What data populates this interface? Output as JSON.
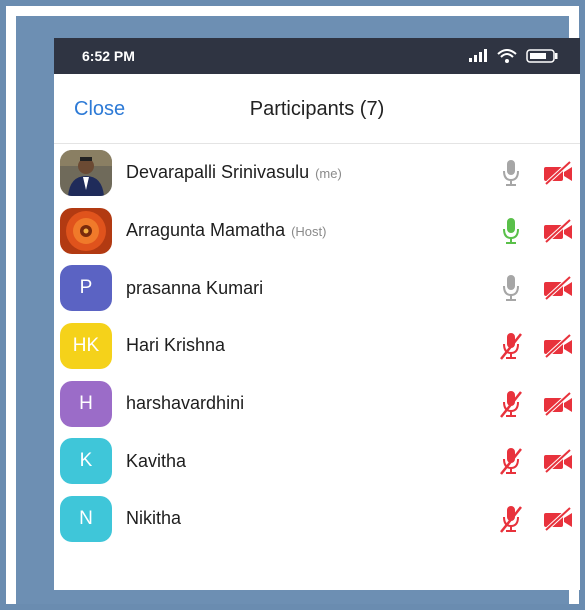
{
  "status_bar": {
    "time": "6:52 PM"
  },
  "header": {
    "close_label": "Close",
    "title": "Participants (7)"
  },
  "participants": [
    {
      "name": "Devarapalli Srinivasulu",
      "tag": "(me)",
      "avatar": "photo",
      "mic": "on",
      "video": "off"
    },
    {
      "name": "Arragunta Mamatha",
      "tag": "(Host)",
      "avatar": "photo",
      "mic": "speaking",
      "video": "off"
    },
    {
      "name": "prasanna Kumari",
      "tag": "",
      "avatar": "P",
      "avatar_color": "#5b63c3",
      "mic": "on",
      "video": "off"
    },
    {
      "name": "Hari Krishna",
      "tag": "",
      "avatar": "HK",
      "avatar_color": "#f5d21a",
      "mic": "muted",
      "video": "off"
    },
    {
      "name": "harshavardhini",
      "tag": "",
      "avatar": "H",
      "avatar_color": "#9b6cc8",
      "mic": "muted",
      "video": "off"
    },
    {
      "name": "Kavitha",
      "tag": "",
      "avatar": "K",
      "avatar_color": "#3fc6d9",
      "mic": "muted",
      "video": "off"
    },
    {
      "name": "Nikitha",
      "tag": "",
      "avatar": "N",
      "avatar_color": "#3fc6d9",
      "mic": "muted",
      "video": "off"
    }
  ],
  "colors": {
    "accent": "#2d7ad6",
    "mic_on": "#a6a6a6",
    "mic_speaking": "#5ac04a",
    "muted": "#e8323c"
  }
}
